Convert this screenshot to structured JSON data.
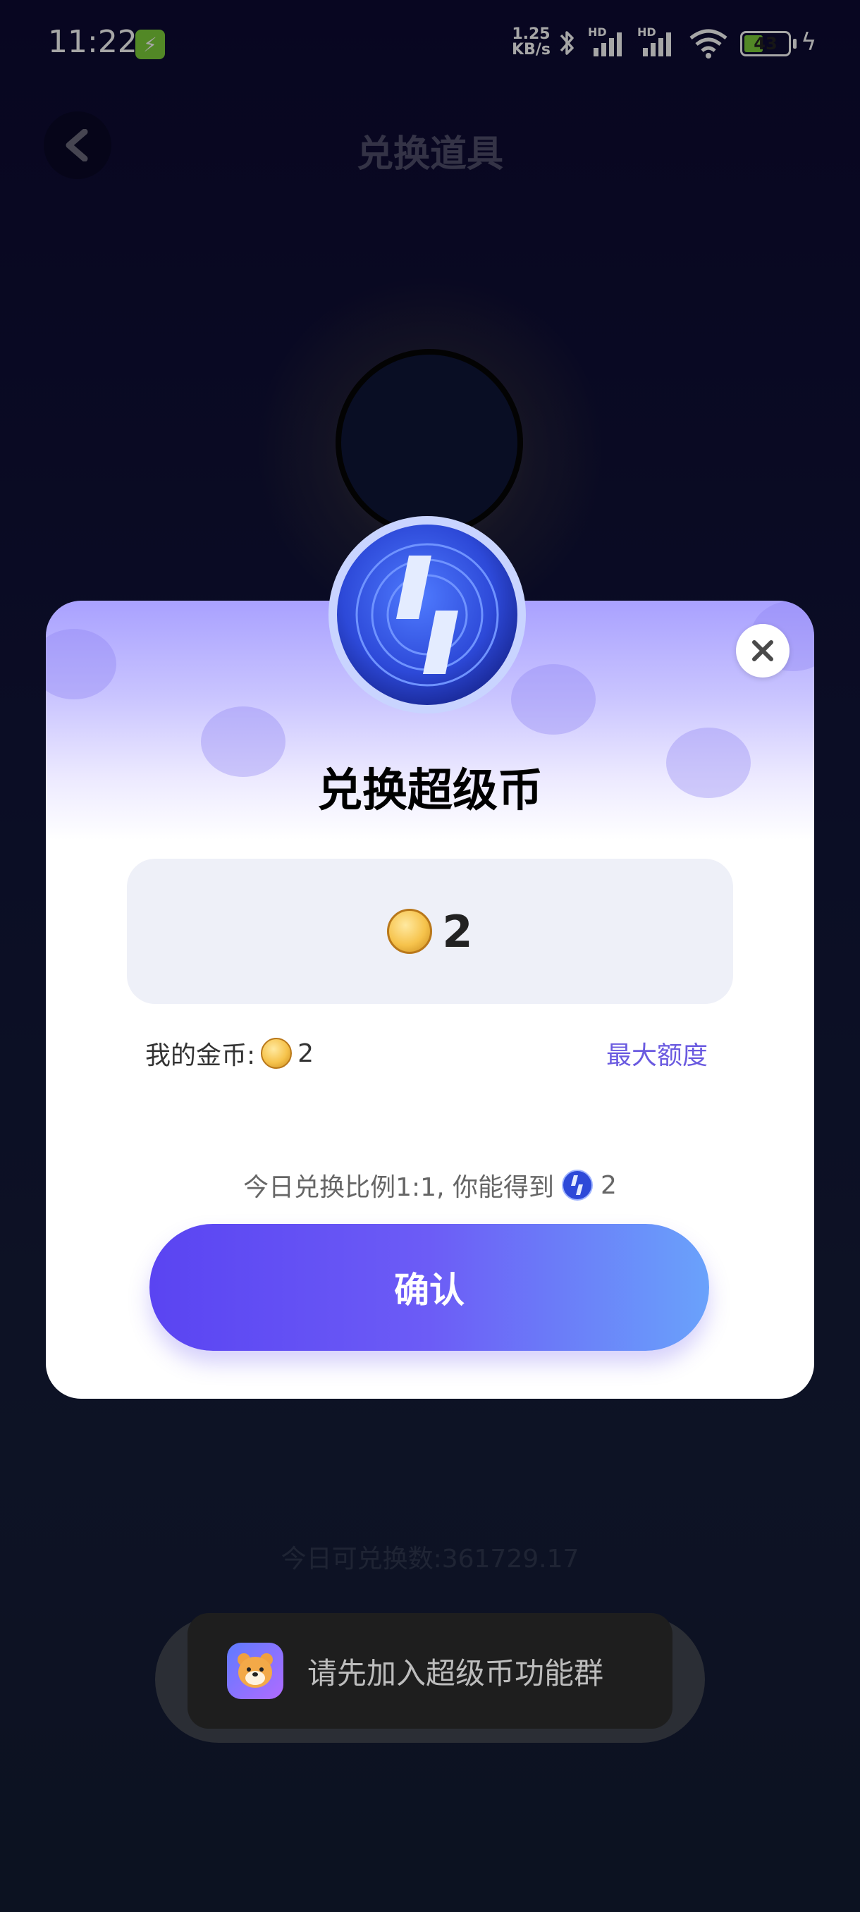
{
  "status_bar": {
    "time": "11:22",
    "net_speed_value": "1.25",
    "net_speed_unit": "KB/s",
    "battery": "43",
    "hd1": "HD",
    "hd2": "HD"
  },
  "header": {
    "title": "兑换道具"
  },
  "modal": {
    "title": "兑换超级币",
    "amount": "2",
    "my_coins_label": "我的金币:",
    "my_coins_value": "2",
    "max_link": "最大额度",
    "ratio_text": "今日兑换比例1:1, 你能得到",
    "ratio_value": "2",
    "confirm_label": "确认"
  },
  "footer": {
    "today_count": "今日可兑换数:361729.17"
  },
  "toast": {
    "text": "请先加入超级币功能群"
  },
  "colors": {
    "accent": "#6a5ae0",
    "button_start": "#5a44f2",
    "button_end": "#6aa2fb",
    "battery_green": "#7fd13b"
  },
  "battery_level": 0.43
}
